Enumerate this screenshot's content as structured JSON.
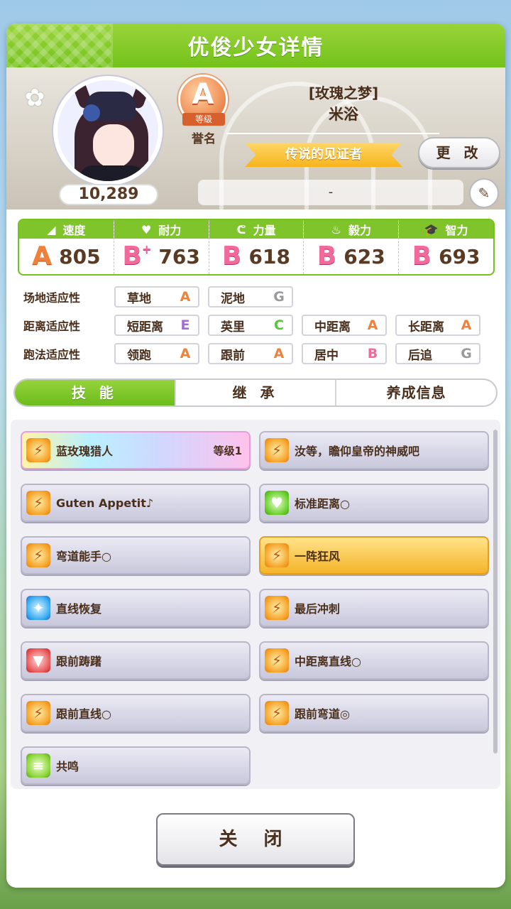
{
  "window": {
    "title": "优俊少女详情"
  },
  "profile": {
    "fans": "10,289",
    "rank_letter": "A",
    "rank_ribbon": "等级",
    "rank_name": "誉名",
    "subtitle": "[玫瑰之梦]",
    "name": "米浴",
    "title_banner": "传说的见证者",
    "change_label": "更 改",
    "motto": "-"
  },
  "stats": [
    {
      "label": "速度",
      "icon": "shoe-icon",
      "glyph": "◢",
      "grade": "A",
      "plus": "",
      "value": "805"
    },
    {
      "label": "耐力",
      "icon": "heart-icon",
      "glyph": "♥",
      "grade": "B",
      "plus": "+",
      "value": "763"
    },
    {
      "label": "力量",
      "icon": "muscle-icon",
      "glyph": "ᕦ",
      "grade": "B",
      "plus": "",
      "value": "618"
    },
    {
      "label": "毅力",
      "icon": "flame-icon",
      "glyph": "♨",
      "grade": "B",
      "plus": "",
      "value": "623"
    },
    {
      "label": "智力",
      "icon": "grad-cap-icon",
      "glyph": "🎓",
      "grade": "B",
      "plus": "",
      "value": "693"
    }
  ],
  "aptitude": {
    "field": {
      "label": "场地适应性",
      "items": [
        {
          "name": "草地",
          "grade": "A"
        },
        {
          "name": "泥地",
          "grade": "G"
        }
      ]
    },
    "distance": {
      "label": "距离适应性",
      "items": [
        {
          "name": "短距离",
          "grade": "E"
        },
        {
          "name": "英里",
          "grade": "C"
        },
        {
          "name": "中距离",
          "grade": "A"
        },
        {
          "name": "长距离",
          "grade": "A"
        }
      ]
    },
    "style": {
      "label": "跑法适应性",
      "items": [
        {
          "name": "领跑",
          "grade": "A"
        },
        {
          "name": "跟前",
          "grade": "A"
        },
        {
          "name": "居中",
          "grade": "B"
        },
        {
          "name": "后追",
          "grade": "G"
        }
      ]
    }
  },
  "tabs": [
    "技 能",
    "继 承",
    "养成信息"
  ],
  "skills": [
    {
      "name": "蓝玫瑰猎人",
      "level": "等级1",
      "style": "rainbow",
      "icon": "orange"
    },
    {
      "name": "汝等，瞻仰皇帝的神威吧",
      "level": "",
      "style": "normal",
      "icon": "orange"
    },
    {
      "name": "Guten Appetit♪",
      "level": "",
      "style": "normal",
      "icon": "orange"
    },
    {
      "name": "标准距离○",
      "level": "",
      "style": "normal",
      "icon": "green"
    },
    {
      "name": "弯道能手○",
      "level": "",
      "style": "normal",
      "icon": "orange"
    },
    {
      "name": "一阵狂风",
      "level": "",
      "style": "gold",
      "icon": "orange"
    },
    {
      "name": "直线恢复",
      "level": "",
      "style": "normal",
      "icon": "blue"
    },
    {
      "name": "最后冲刺",
      "level": "",
      "style": "normal",
      "icon": "orange"
    },
    {
      "name": "跟前踌躇",
      "level": "",
      "style": "normal",
      "icon": "red"
    },
    {
      "name": "中距离直线○",
      "level": "",
      "style": "normal",
      "icon": "orange"
    },
    {
      "name": "跟前直线○",
      "level": "",
      "style": "normal",
      "icon": "orange"
    },
    {
      "name": "跟前弯道◎",
      "level": "",
      "style": "normal",
      "icon": "orange"
    },
    {
      "name": "共鸣",
      "level": "",
      "style": "normal",
      "icon": "lime"
    }
  ],
  "close_label": "关 闭"
}
